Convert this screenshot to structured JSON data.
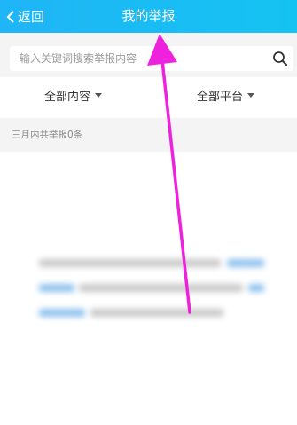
{
  "header": {
    "back_label": "返回",
    "title": "我的举报"
  },
  "search": {
    "placeholder": "输入关键词搜索举报内容",
    "value": ""
  },
  "filters": [
    {
      "label": "全部内容"
    },
    {
      "label": "全部平台"
    }
  ],
  "summary": {
    "count_text": "三月内共举报0条"
  },
  "icons": {
    "back": "chevron-left-icon",
    "search": "search-icon",
    "dropdown": "caret-down-icon"
  },
  "colors": {
    "header_bg": "#1fb5f6",
    "link_blue": "#4aa3ea",
    "arrow_annotation": "#ee22dd"
  }
}
